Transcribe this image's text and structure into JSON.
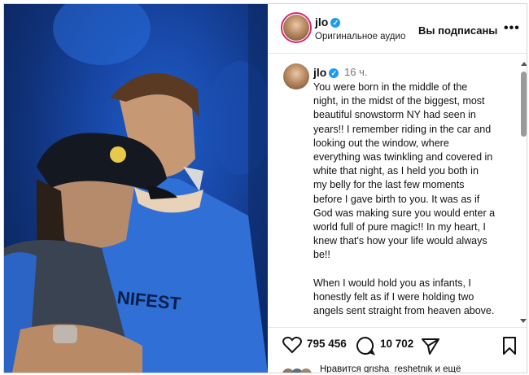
{
  "header": {
    "username": "jlo",
    "subtitle": "Оригинальное аудио",
    "follow_status": "Вы подписаны",
    "more": "•••"
  },
  "post": {
    "username": "jlo",
    "time": "16 ч.",
    "caption": "You were born in the middle of the\nnight, in the midst of the biggest, most\nbeautiful snowstorm NY had seen in\nyears!! I remember riding in the car and\nlooking out the window, where\neverything was twinkling and covered in\nwhite that night, as I held you both in\nmy belly for the last few moments\nbefore I gave birth to you. It was as if\nGod was making sure you would enter a\nworld full of pure magic!! In my heart, I\nknew that's how your life would always\nbe!!\n\nWhen I would hold you as infants, I\nhonestly felt as if I were holding two\nangels sent straight from heaven above."
  },
  "actions": {
    "likes_count": "795 456",
    "comments_count": "10 702"
  },
  "footer": {
    "liked_by": "Нравится grisha_reshetnik и ещё"
  },
  "media": {
    "shirt_text": "MANIFEST"
  },
  "colors": {
    "verified": "#1d9bf0",
    "stage_blue": "#1848a8"
  }
}
